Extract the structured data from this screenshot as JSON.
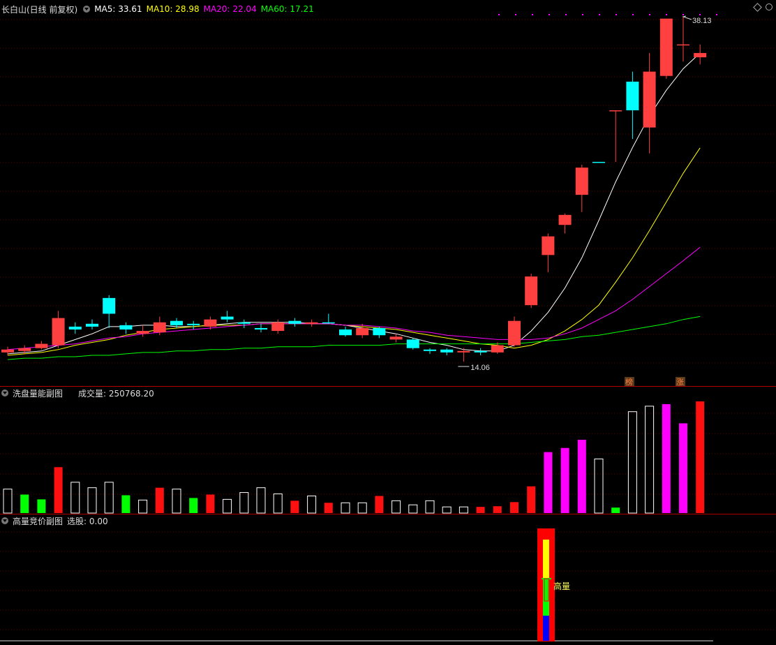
{
  "main_panel": {
    "title": "长白山(日线 前复权)",
    "indicators": [
      {
        "label": "MA5: 33.61",
        "color": "#ffffff"
      },
      {
        "label": "MA10: 28.98",
        "color": "#ffff00"
      },
      {
        "label": "MA20: 22.04",
        "color": "#ff00ff"
      },
      {
        "label": "MA60: 17.21",
        "color": "#00ff00"
      }
    ],
    "high_label": "38.13",
    "low_label": "14.06",
    "tags": [
      "榜",
      "涨"
    ]
  },
  "volume_panel": {
    "title": "洗盘量能副图",
    "indicator_label": "成交量: 250768.20"
  },
  "auction_panel": {
    "title": "高量竞价副图",
    "indicator_label": "选股: 0.00",
    "signal_text": "高量"
  },
  "colors": {
    "up": "#ff4040",
    "down": "#00ffff",
    "ma5": "#ffffff",
    "ma10": "#ffff00",
    "ma20": "#ff00ff",
    "ma60": "#00ff00",
    "grid": "#660000"
  },
  "icons": [
    "collapse-toggle-icon",
    "diamond-icon",
    "settings-circle-icon"
  ],
  "chart_data": [
    {
      "type": "candlestick",
      "candles": [
        [
          14.9,
          14.7,
          15.1,
          14.5
        ],
        [
          14.8,
          15.0,
          15.2,
          14.6
        ],
        [
          15.0,
          15.3,
          15.5,
          14.9
        ],
        [
          15.2,
          17.1,
          17.6,
          15.0
        ],
        [
          16.5,
          16.3,
          16.8,
          16.0
        ],
        [
          16.5,
          16.7,
          17.0,
          16.3
        ],
        [
          17.4,
          18.5,
          18.7,
          16.4
        ],
        [
          16.6,
          16.3,
          16.8,
          16.0
        ],
        [
          16.0,
          16.2,
          16.6,
          15.8
        ],
        [
          16.1,
          16.8,
          17.2,
          15.9
        ],
        [
          16.9,
          16.6,
          17.1,
          16.4
        ],
        [
          16.6,
          16.7,
          16.9,
          16.3
        ],
        [
          16.5,
          17.0,
          17.2,
          16.3
        ],
        [
          17.0,
          17.2,
          17.6,
          16.8
        ],
        [
          16.8,
          16.7,
          17.0,
          16.4
        ],
        [
          16.4,
          16.3,
          16.7,
          16.1
        ],
        [
          16.2,
          16.8,
          17.0,
          16.0
        ],
        [
          16.9,
          16.7,
          17.1,
          16.5
        ],
        [
          16.7,
          16.8,
          17.0,
          16.5
        ],
        [
          16.8,
          16.8,
          17.4,
          16.7
        ],
        [
          16.3,
          15.9,
          16.5,
          15.8
        ],
        [
          15.9,
          16.4,
          16.7,
          15.7
        ],
        [
          16.4,
          15.9,
          16.5,
          15.7
        ],
        [
          15.6,
          15.8,
          16.0,
          15.4
        ],
        [
          15.6,
          15.0,
          15.7,
          14.9
        ],
        [
          14.9,
          14.8,
          15.0,
          14.6
        ],
        [
          14.9,
          14.7,
          15.0,
          14.5
        ],
        [
          14.7,
          14.8,
          15.0,
          14.06
        ],
        [
          14.7,
          14.8,
          15.0,
          14.5
        ],
        [
          14.7,
          15.2,
          15.4,
          14.6
        ],
        [
          15.2,
          16.9,
          17.2,
          15.1
        ],
        [
          18.0,
          20.0,
          20.2,
          17.8
        ],
        [
          21.5,
          22.8,
          23.0,
          20.3
        ],
        [
          23.6,
          24.3,
          24.4,
          23.0
        ],
        [
          25.7,
          27.6,
          27.8,
          24.5
        ],
        [
          28.0,
          28.0,
          28.0,
          28.0
        ],
        [
          31.6,
          31.6,
          31.6,
          28.0
        ],
        [
          33.6,
          31.6,
          34.3,
          29.6
        ],
        [
          30.4,
          34.3,
          35.6,
          28.6
        ],
        [
          34.0,
          38.0,
          38.0,
          33.8
        ],
        [
          36.2,
          36.2,
          38.13,
          35.0
        ],
        [
          35.3,
          35.6,
          36.2,
          34.8
        ]
      ],
      "candle_format": "open, close, high, low",
      "candle_directions": [
        "up",
        "up",
        "up",
        "up",
        "down",
        "down",
        "down",
        "down",
        "up",
        "up",
        "down",
        "down",
        "up",
        "down",
        "down",
        "down",
        "up",
        "down",
        "up",
        "down",
        "down",
        "up",
        "down",
        "up",
        "down",
        "down",
        "down",
        "up",
        "down",
        "up",
        "up",
        "up",
        "up",
        "up",
        "up",
        "down",
        "up",
        "down",
        "up",
        "up",
        "up",
        "up"
      ],
      "moving_averages": {
        "MA5": [
          14.6,
          14.7,
          14.8,
          15.2,
          15.6,
          16.0,
          16.5,
          16.5,
          16.6,
          16.6,
          16.5,
          16.5,
          16.6,
          16.7,
          16.8,
          16.8,
          16.8,
          16.8,
          16.7,
          16.7,
          16.6,
          16.4,
          16.2,
          16.0,
          15.7,
          15.4,
          15.2,
          14.9,
          14.8,
          14.8,
          15.2,
          16.2,
          17.5,
          19.2,
          21.3,
          23.9,
          26.6,
          29.0,
          31.2,
          33.0,
          34.5,
          35.6
        ],
        "MA10": [
          14.5,
          14.6,
          14.7,
          14.9,
          15.2,
          15.4,
          15.6,
          15.9,
          16.1,
          16.3,
          16.4,
          16.5,
          16.6,
          16.6,
          16.6,
          16.7,
          16.7,
          16.7,
          16.7,
          16.7,
          16.6,
          16.5,
          16.4,
          16.3,
          16.1,
          15.9,
          15.7,
          15.5,
          15.3,
          15.2,
          15.0,
          15.2,
          15.6,
          16.2,
          17.0,
          18.0,
          19.6,
          21.3,
          23.2,
          25.2,
          27.2,
          28.98
        ],
        "MA20": [
          14.9,
          15.0,
          15.1,
          15.2,
          15.3,
          15.5,
          15.7,
          15.8,
          16.0,
          16.1,
          16.2,
          16.3,
          16.4,
          16.5,
          16.6,
          16.7,
          16.7,
          16.7,
          16.7,
          16.7,
          16.6,
          16.6,
          16.5,
          16.4,
          16.2,
          16.1,
          15.9,
          15.8,
          15.7,
          15.6,
          15.6,
          15.6,
          15.7,
          16.0,
          16.4,
          17.0,
          17.6,
          18.4,
          19.3,
          20.2,
          21.1,
          22.04
        ],
        "MA60": [
          14.2,
          14.3,
          14.3,
          14.4,
          14.4,
          14.5,
          14.5,
          14.6,
          14.7,
          14.7,
          14.8,
          14.8,
          14.9,
          14.9,
          15.0,
          15.0,
          15.1,
          15.1,
          15.1,
          15.2,
          15.2,
          15.2,
          15.2,
          15.3,
          15.3,
          15.3,
          15.3,
          15.3,
          15.3,
          15.3,
          15.3,
          15.4,
          15.5,
          15.6,
          15.8,
          15.9,
          16.1,
          16.3,
          16.5,
          16.7,
          17.0,
          17.21
        ]
      },
      "series": [
        {
          "name": "MA5",
          "last": 33.61
        },
        {
          "name": "MA10",
          "last": 28.98
        },
        {
          "name": "MA20",
          "last": 22.04
        },
        {
          "name": "MA60",
          "last": 17.21
        }
      ],
      "annotations": [
        "38.13",
        "14.06"
      ],
      "grid": true
    },
    {
      "type": "bar",
      "volumes": [
        35,
        27,
        20,
        67,
        45,
        37,
        45,
        26,
        19,
        37,
        35,
        22,
        27,
        20,
        30,
        37,
        28,
        18,
        25,
        15,
        15,
        15,
        25,
        18,
        12,
        18,
        9,
        9,
        9,
        10,
        16,
        39,
        89,
        95,
        107,
        79,
        8,
        148,
        156,
        159,
        131,
        163
      ],
      "bar_styles": [
        "hollow",
        "green",
        "green",
        "red",
        "hollow",
        "hollow",
        "hollow",
        "green",
        "hollow",
        "red",
        "hollow",
        "green",
        "red",
        "hollow",
        "hollow",
        "hollow",
        "hollow",
        "red",
        "hollow",
        "red",
        "hollow",
        "hollow",
        "red",
        "hollow",
        "hollow",
        "hollow",
        "hollow",
        "hollow",
        "red",
        "red",
        "red",
        "red",
        "magenta",
        "magenta",
        "magenta",
        "hollow",
        "green",
        "hollow",
        "hollow",
        "magenta",
        "magenta",
        "red",
        "green"
      ],
      "last_value": 250768.2
    },
    {
      "type": "bar",
      "selection_value": 0.0,
      "signal_label": "高量"
    }
  ]
}
